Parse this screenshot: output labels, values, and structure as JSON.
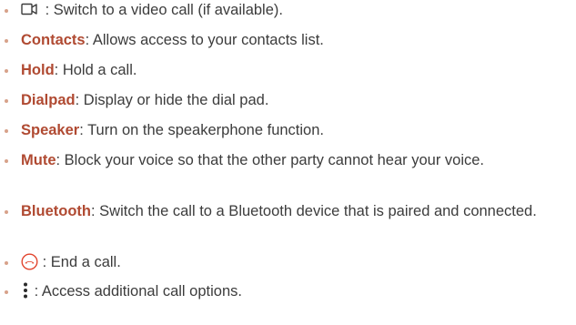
{
  "colors": {
    "term": "#b04a32",
    "text": "#3c3c3c",
    "bullet": "#d7a28a",
    "end_call_icon": "#e2452e"
  },
  "items": [
    {
      "icon": "video-call-icon",
      "separator": " : ",
      "description": "Switch to a video call (if available)."
    },
    {
      "term": "Contacts",
      "separator": ": ",
      "description": "Allows access to your contacts list."
    },
    {
      "term": "Hold",
      "separator": ": ",
      "description": "Hold a call."
    },
    {
      "term": "Dialpad",
      "separator": ": ",
      "description": "Display or hide the dial pad."
    },
    {
      "term": "Speaker",
      "separator": ": ",
      "description": "Turn on the speakerphone function."
    },
    {
      "term": "Mute",
      "separator": ": ",
      "description": "Block your voice so that the other party cannot hear your voice."
    },
    {
      "term": "Bluetooth",
      "separator": ": ",
      "description": "Switch the call to a Bluetooth device that is paired and connected."
    },
    {
      "icon": "end-call-icon",
      "separator": " : ",
      "description": "End a call."
    },
    {
      "icon": "more-options-icon",
      "separator": " : ",
      "description": "Access additional call options."
    }
  ]
}
